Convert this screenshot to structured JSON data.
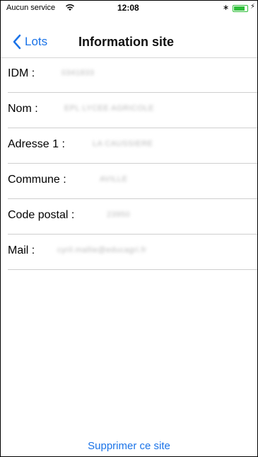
{
  "status_bar": {
    "carrier": "Aucun service",
    "time": "12:08",
    "battery_level": 0.75,
    "accent_green": "#2fbf3a"
  },
  "nav": {
    "back_label": "Lots",
    "title": "Information site",
    "accent": "#1a73e8"
  },
  "fields": [
    {
      "label": "IDM  :",
      "value": "0341833"
    },
    {
      "label": "Nom  :",
      "value": "EPL LYCEE AGRICOLE"
    },
    {
      "label": "Adresse 1  :",
      "value": "LA CAUSSIERE"
    },
    {
      "label": "Commune  :",
      "value": "AVILLE"
    },
    {
      "label": "Code postal  :",
      "value": "23950"
    },
    {
      "label": "Mail  :",
      "value": "cyril.mallie@educagri.fr"
    }
  ],
  "actions": {
    "delete_label": "Supprimer ce site"
  }
}
